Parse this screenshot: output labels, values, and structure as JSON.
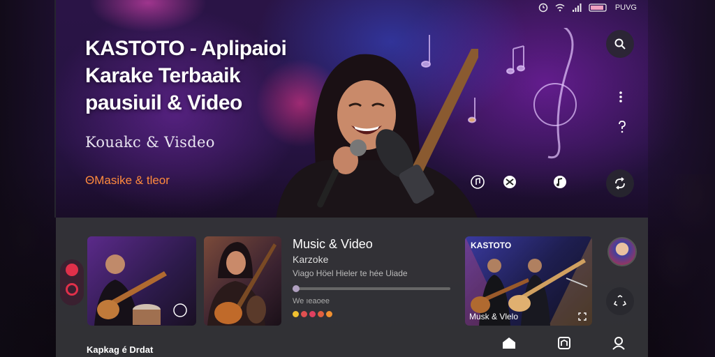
{
  "status_bar": {
    "label": "PUVG"
  },
  "hero": {
    "title_lines": [
      "KASTOTO - Aplipaioi",
      "Karake  Terbaaik",
      "pausiuil & Video"
    ],
    "subtitle": "Kouakc & Visdeo",
    "tagline": "ΘMasike & tleor"
  },
  "colors": {
    "accent_orange": "#ff8a3d",
    "record_red": "#e0304a",
    "panel_bg": "#343438"
  },
  "featured": {
    "title": "Music & Video",
    "subtitle": "Karzoke",
    "description": "Viago Höel Hieler te hée Uiade",
    "progress": 0.02,
    "meta": "We ıeaoee",
    "rating_dots": [
      "#f0c030",
      "#e05050",
      "#e04060",
      "#e06040",
      "#f09030"
    ]
  },
  "thumbnails": [
    {
      "name": "guitar-player-card"
    },
    {
      "name": "singer-guitar-card"
    },
    {
      "title": "KASTOTO",
      "caption": "Musk & Vlelo"
    }
  ],
  "section": {
    "title": "Kapkag é Drdat"
  },
  "icons": {
    "search": "search-icon",
    "more": "more-vertical-icon",
    "help": "question-icon",
    "refresh": "refresh-icon",
    "home": "home-icon",
    "library": "library-icon",
    "profile": "profile-icon"
  }
}
